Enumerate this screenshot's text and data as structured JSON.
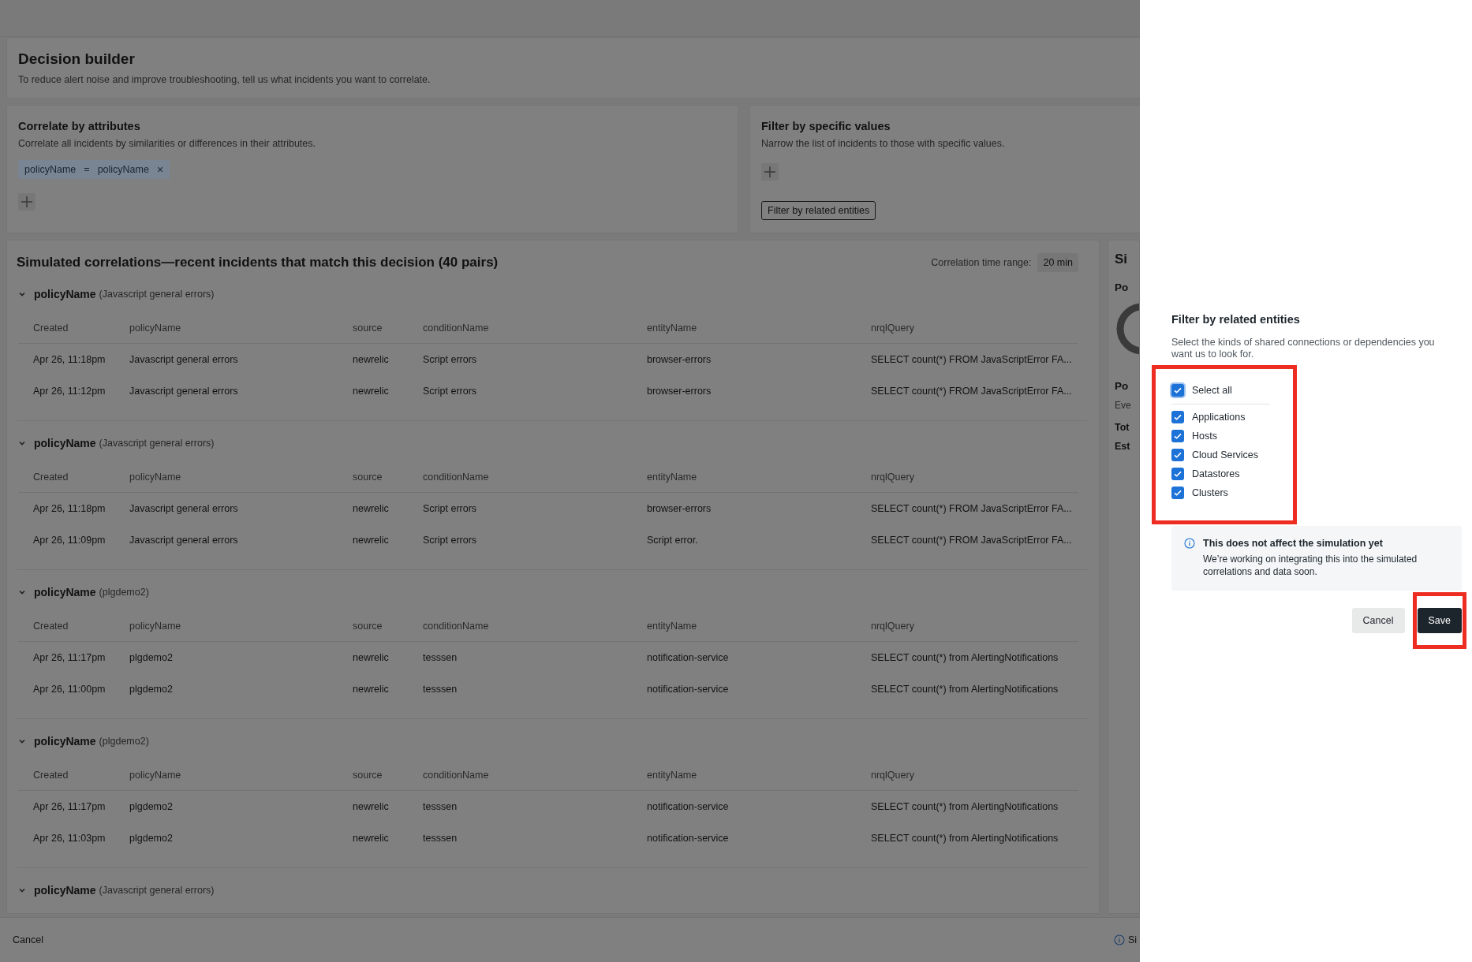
{
  "header": {
    "title": "Decision builder",
    "subtitle": "To reduce alert noise and improve troubleshooting, tell us what incidents you want to correlate."
  },
  "correlate": {
    "title": "Correlate by attributes",
    "description": "Correlate all incidents by similarities or differences in their attributes.",
    "chips": [
      {
        "left": "policyName",
        "operator": "=",
        "right": "policyName",
        "remove": "×"
      }
    ]
  },
  "filter": {
    "title": "Filter by specific values",
    "description": "Narrow the list of incidents to those with specific values.",
    "related_button": "Filter by related entities"
  },
  "simulation": {
    "title": "Simulated correlations—recent incidents that match this decision (40 pairs)",
    "time_range_label": "Correlation time range:",
    "time_range": "20 min",
    "groups": [
      {
        "attribute": "policyName",
        "value": "(Javascript general errors)",
        "expanded": true,
        "columns": [
          "Created",
          "policyName",
          "source",
          "conditionName",
          "entityName",
          "nrqlQuery"
        ],
        "rows": [
          [
            "Apr 26, 11:18pm",
            "Javascript general errors",
            "newrelic",
            "Script errors",
            "browser-errors",
            "SELECT count(*) FROM JavaScriptError FA..."
          ],
          [
            "Apr 26, 11:12pm",
            "Javascript general errors",
            "newrelic",
            "Script errors",
            "browser-errors",
            "SELECT count(*) FROM JavaScriptError FA..."
          ]
        ]
      },
      {
        "attribute": "policyName",
        "value": "(Javascript general errors)",
        "expanded": true,
        "columns": [
          "Created",
          "policyName",
          "source",
          "conditionName",
          "entityName",
          "nrqlQuery"
        ],
        "rows": [
          [
            "Apr 26, 11:18pm",
            "Javascript general errors",
            "newrelic",
            "Script errors",
            "browser-errors",
            "SELECT count(*) FROM JavaScriptError FA..."
          ],
          [
            "Apr 26, 11:09pm",
            "Javascript general errors",
            "newrelic",
            "Script errors",
            "Script error.",
            "SELECT count(*) FROM JavaScriptError FA..."
          ]
        ]
      },
      {
        "attribute": "policyName",
        "value": "(plgdemo2)",
        "expanded": true,
        "columns": [
          "Created",
          "policyName",
          "source",
          "conditionName",
          "entityName",
          "nrqlQuery"
        ],
        "rows": [
          [
            "Apr 26, 11:17pm",
            "plgdemo2",
            "newrelic",
            "tesssen",
            "notification-service",
            "SELECT count(*) from AlertingNotifications"
          ],
          [
            "Apr 26, 11:00pm",
            "plgdemo2",
            "newrelic",
            "tesssen",
            "notification-service",
            "SELECT count(*) from AlertingNotifications"
          ]
        ]
      },
      {
        "attribute": "policyName",
        "value": "(plgdemo2)",
        "expanded": true,
        "columns": [
          "Created",
          "policyName",
          "source",
          "conditionName",
          "entityName",
          "nrqlQuery"
        ],
        "rows": [
          [
            "Apr 26, 11:17pm",
            "plgdemo2",
            "newrelic",
            "tesssen",
            "notification-service",
            "SELECT count(*) from AlertingNotifications"
          ],
          [
            "Apr 26, 11:03pm",
            "plgdemo2",
            "newrelic",
            "tesssen",
            "notification-service",
            "SELECT count(*) from AlertingNotifications"
          ]
        ]
      },
      {
        "attribute": "policyName",
        "value": "(Javascript general errors)",
        "expanded": true
      }
    ]
  },
  "side_panel": {
    "title": "Si",
    "texts": [
      {
        "kind": "heading",
        "text": "Po"
      },
      {
        "kind": "ring"
      },
      {
        "kind": "heading",
        "text": "Po"
      },
      {
        "kind": "caption",
        "text": "Eve"
      },
      {
        "kind": "stat",
        "text": "Tot"
      },
      {
        "kind": "stat",
        "text": "Est"
      }
    ]
  },
  "footer": {
    "cancel": "Cancel",
    "info": "Si"
  },
  "drawer": {
    "title": "Filter by related entities",
    "description": "Select the kinds of shared connections or dependencies you want us to look for.",
    "select_all": {
      "label": "Select all",
      "checked": true
    },
    "options": [
      {
        "label": "Applications",
        "checked": true
      },
      {
        "label": "Hosts",
        "checked": true
      },
      {
        "label": "Cloud Services",
        "checked": true
      },
      {
        "label": "Datastores",
        "checked": true
      },
      {
        "label": "Clusters",
        "checked": true
      }
    ],
    "notice": {
      "title": "This does not affect the simulation yet",
      "text": "We’re working on integrating this into the simulated correlations and data soon."
    },
    "cancel": "Cancel",
    "save": "Save",
    "highlight_options": true,
    "highlight_save": true
  }
}
